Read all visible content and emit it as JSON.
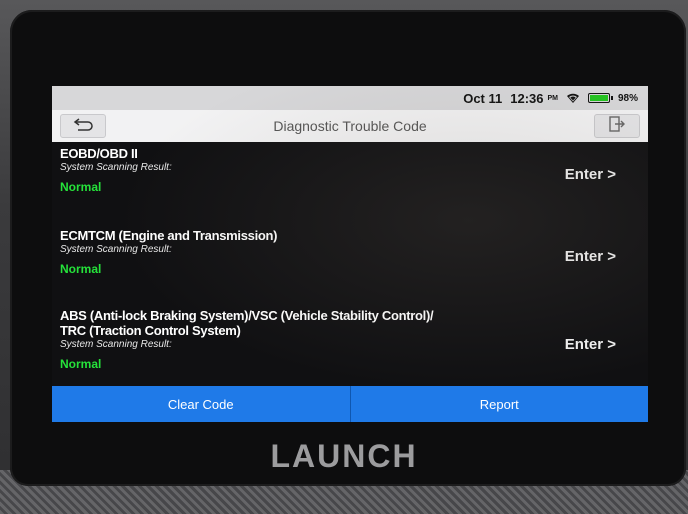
{
  "status": {
    "date": "Oct 11",
    "time": "12:36",
    "ampm": "PM",
    "battery_percent": "98%",
    "battery_level": 0.98
  },
  "header": {
    "title": "Diagnostic Trouble Code",
    "back_icon": "back-arrow-icon",
    "exit_icon": "exit-icon"
  },
  "systems": [
    {
      "name": "EOBD/OBD II",
      "sub": "System Scanning Result:",
      "status": "Normal",
      "action": "Enter >"
    },
    {
      "name": "ECMTCM (Engine and Transmission)",
      "sub": "System Scanning Result:",
      "status": "Normal",
      "action": "Enter >"
    },
    {
      "name_line1": "ABS (Anti-lock Braking System)/VSC (Vehicle Stability Control)/",
      "name_line2": "TRC (Traction Control System)",
      "sub": "System Scanning Result:",
      "status": "Normal",
      "action": "Enter >"
    }
  ],
  "footer": {
    "clear_label": "Clear Code",
    "report_label": "Report"
  },
  "brand": {
    "logo_text": "LAUNCH"
  },
  "colors": {
    "accent": "#1f7ae8",
    "status_ok": "#25e23a"
  }
}
